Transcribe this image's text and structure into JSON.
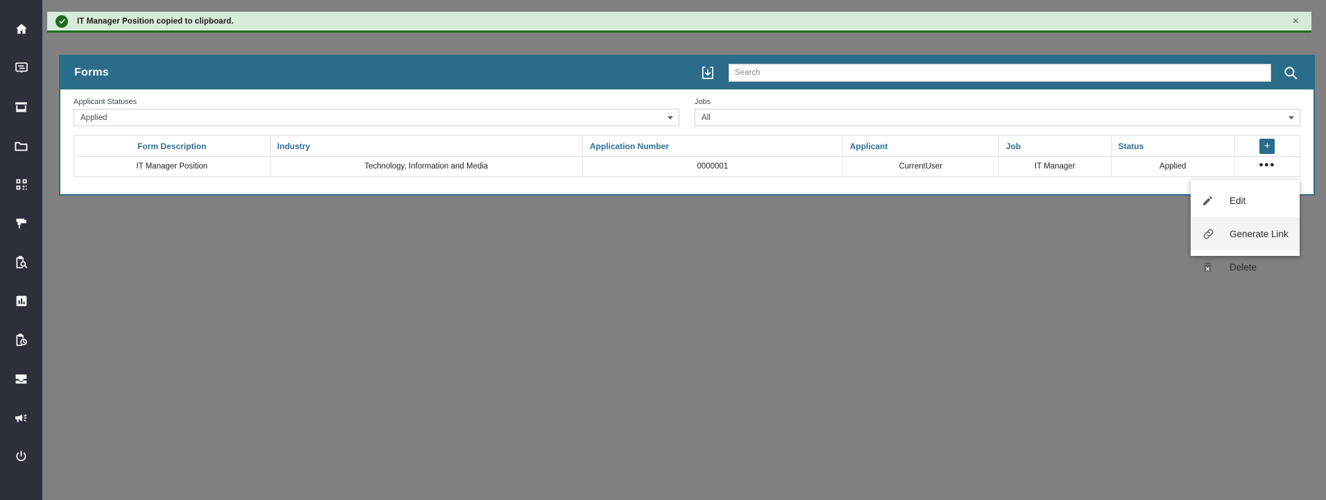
{
  "alert": {
    "message": "IT Manager Position copied to clipboard.",
    "close_label": "×",
    "icon": "check-circle-icon",
    "bg_color": "#d8ead8",
    "accent_color": "#1d6b1d"
  },
  "sidebar": {
    "bg_color": "#2b303b",
    "items": [
      {
        "name": "home-icon"
      },
      {
        "name": "messages-icon"
      },
      {
        "name": "store-icon"
      },
      {
        "name": "folder-icon"
      },
      {
        "name": "qr-code-icon"
      },
      {
        "name": "paint-roller-icon"
      },
      {
        "name": "clipboard-search-icon"
      },
      {
        "name": "chart-bar-icon"
      },
      {
        "name": "clipboard-clock-icon"
      },
      {
        "name": "inbox-icon"
      },
      {
        "name": "megaphone-icon"
      },
      {
        "name": "power-icon"
      }
    ]
  },
  "card": {
    "title": "Forms",
    "accent_color": "#2a6c8a",
    "export_icon": "export-download-icon",
    "search": {
      "placeholder": "Search",
      "value": "",
      "button_icon": "search-icon"
    }
  },
  "filters": [
    {
      "label": "Applicant Statuses",
      "value": "Applied"
    },
    {
      "label": "Jobs",
      "value": "All"
    }
  ],
  "table": {
    "columns": [
      "Form Description",
      "Industry",
      "Application Number",
      "Applicant",
      "Job",
      "Status"
    ],
    "add_button_label": "+",
    "row_menu_label": "•••",
    "rows": [
      {
        "form_description": "IT Manager Position",
        "industry": "Technology, Information and Media",
        "application_number": "0000001",
        "applicant": "CurrentUser",
        "job": "IT Manager",
        "status": "Applied"
      }
    ]
  },
  "context_menu": {
    "items": [
      {
        "label": "Edit",
        "icon": "pencil-icon",
        "hovered": false
      },
      {
        "label": "Generate Link",
        "icon": "link-icon",
        "hovered": true
      },
      {
        "label": "Delete",
        "icon": "trash-icon",
        "hovered": false
      }
    ]
  }
}
